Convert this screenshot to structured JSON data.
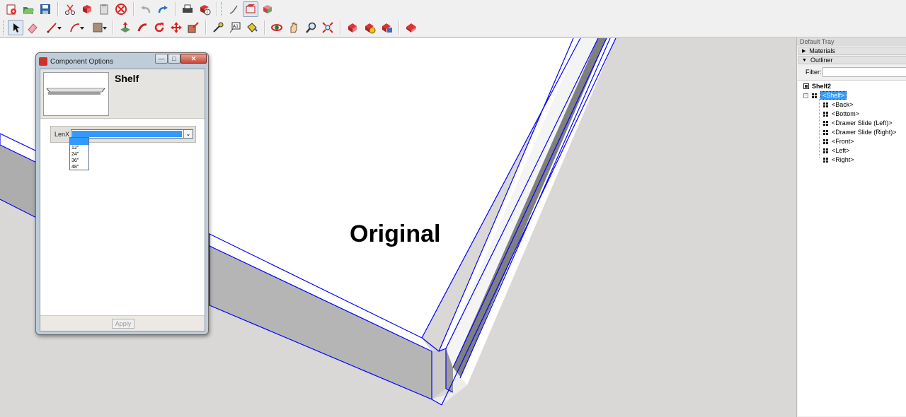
{
  "toolbar": {
    "row1_tools": [
      "new-file-icon",
      "open-folder-icon",
      "save-icon",
      "cut-icon",
      "copy-icon",
      "paste-icon",
      "delete-icon",
      "undo-icon",
      "redo-icon",
      "print-icon",
      "model-info-icon",
      "paint-icon",
      "components-icon",
      "materials-icon"
    ],
    "row2_tools": [
      "select-icon",
      "eraser-icon",
      "line-icon",
      "arc-icon",
      "rectangle-icon",
      "push-pull-icon",
      "follow-me-icon",
      "rotate-icon",
      "move-icon",
      "scale-icon",
      "tape-measure-icon",
      "text-icon",
      "paint-bucket-icon",
      "orbit-icon",
      "pan-icon",
      "zoom-icon",
      "zoom-extents-icon",
      "dynamic-components-icon",
      "component-options-icon",
      "component-attributes-icon",
      "generate-report-icon"
    ]
  },
  "viewport": {
    "model_label": "Original"
  },
  "dialog": {
    "title": "Component Options",
    "component_name": "Shelf",
    "attribute_label": "LenX",
    "selected_value": "",
    "dropdown_options": [
      "",
      "12\"",
      "24\"",
      "36\"",
      "48\""
    ],
    "apply_label": "Apply"
  },
  "tray": {
    "title": "Default Tray",
    "panels": [
      "Materials",
      "Outliner"
    ],
    "filter_label": "Filter:",
    "filter_value": "",
    "outliner": {
      "root": "Shelf2",
      "selected": "<Shelf>",
      "children": [
        "<Back>",
        "<Bottom>",
        "<Drawer Slide (Left)>",
        "<Drawer Slide (Right)>",
        "<Front>",
        "<Left>",
        "<Right>"
      ]
    }
  },
  "colors": {
    "edge_highlight": "#0000ff",
    "selection": "#3399ff",
    "background": "#d9d8d6"
  }
}
